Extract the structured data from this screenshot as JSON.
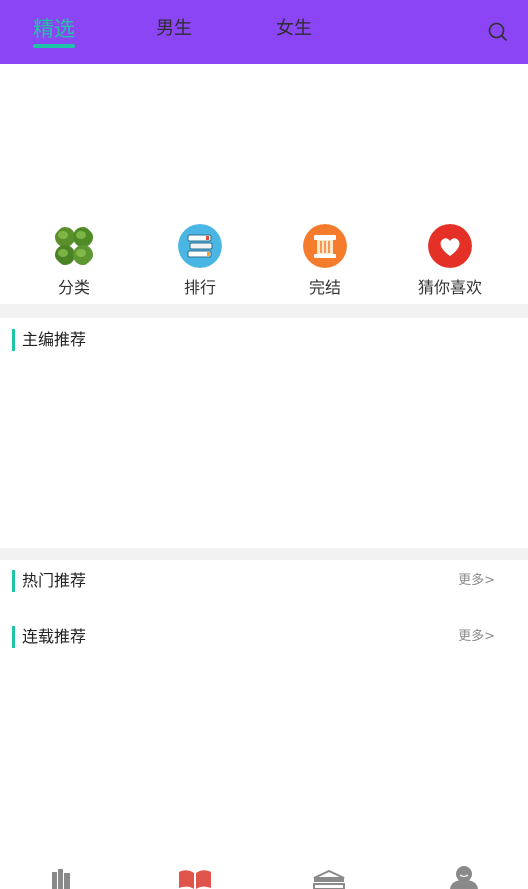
{
  "header": {
    "tabs": [
      {
        "label": "精选",
        "active": true
      },
      {
        "label": "男生",
        "active": false
      },
      {
        "label": "女生",
        "active": false
      }
    ],
    "search_icon": "search-icon",
    "background_color": "#8b45f5",
    "accent_color": "#1fc4a6"
  },
  "categories": [
    {
      "label": "分类",
      "icon": "clover-icon"
    },
    {
      "label": "排行",
      "icon": "book-stack-icon"
    },
    {
      "label": "完结",
      "icon": "pillar-icon"
    },
    {
      "label": "猜你喜欢",
      "icon": "heart-icon"
    }
  ],
  "sections": {
    "editor": {
      "title": "主编推荐"
    },
    "hot": {
      "title": "热门推荐",
      "more": "更多>"
    },
    "serial": {
      "title": "连载推荐",
      "more": "更多>"
    }
  },
  "bottom_nav": [
    {
      "icon": "bookshelf-icon"
    },
    {
      "icon": "open-book-icon"
    },
    {
      "icon": "book-store-icon"
    },
    {
      "icon": "profile-icon"
    }
  ]
}
